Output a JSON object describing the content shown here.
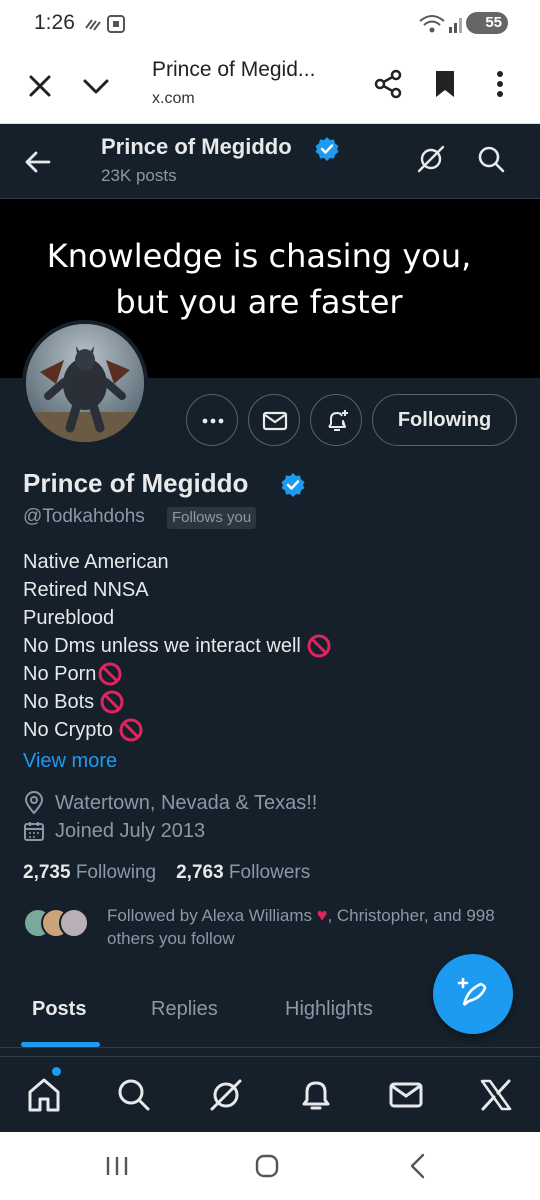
{
  "status_bar": {
    "time": "1:26",
    "battery": "55"
  },
  "browser": {
    "title": "Prince of Megid...",
    "url": "x.com"
  },
  "header": {
    "name": "Prince of Megiddo",
    "posts_count": "23K posts"
  },
  "banner": {
    "line1": "Knowledge is chasing you,",
    "line2": "but you are faster"
  },
  "profile": {
    "follow_button": "Following",
    "name": "Prince of Megiddo",
    "handle": "@Todkahdohs",
    "follows_you": "Follows you",
    "bio": [
      "Native American",
      "Retired NNSA",
      "Pureblood",
      "No Dms unless we interact well",
      "No Porn",
      "No Bots",
      "No Crypto"
    ],
    "view_more": "View more",
    "location": "Watertown, Nevada & Texas!!",
    "joined": "Joined July 2013",
    "following_count": "2,735",
    "following_label": "Following",
    "followers_count": "2,763",
    "followers_label": "Followers",
    "followed_by_pre": "Followed by Alexa Williams",
    "followed_by_post": ", Christopher, and 998 others you follow"
  },
  "tabs": [
    "Posts",
    "Replies",
    "Highlights"
  ],
  "colors": {
    "background": "#15202b",
    "accent": "#1d9bf0",
    "prohibited": "#e0245e"
  },
  "icons": [
    "back-arrow-icon",
    "grok-icon",
    "search-icon",
    "more-icon",
    "mail-icon",
    "notify-plus-icon",
    "home-icon",
    "bell-icon",
    "x-logo-icon",
    "compose-feather-icon"
  ]
}
